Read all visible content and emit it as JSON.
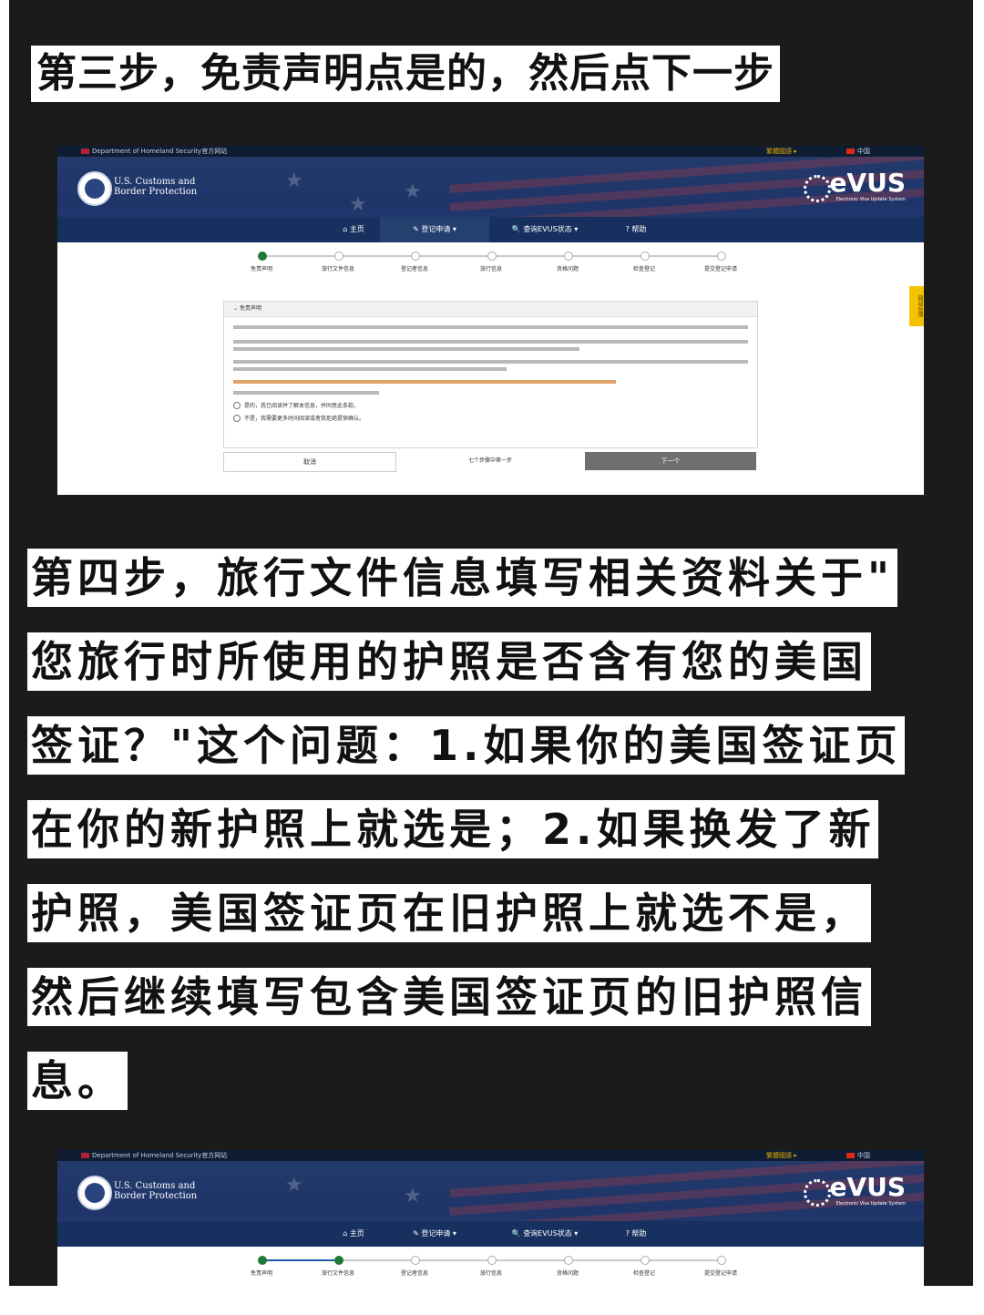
{
  "heading1": "第三步，免责声明点是的，然后点下一步",
  "heading2_lines": [
    "第四步，旅行文件信息填写相关资料关于\"",
    "您旅行时所使用的护照是否含有您的美国",
    "签证？\"这个问题：1.如果你的美国签证页",
    "在你的新护照上就选是；2.如果换发了新",
    "护照，美国签证页在旧护照上就选不是，",
    "然后继续填写包含美国签证页的旧护照信",
    "息。"
  ],
  "screenshot1": {
    "dhs_banner": "Department of Homeland Security官方网站",
    "language_link": "繁體國語 ▸",
    "country": "中国",
    "agency_name": [
      "U.S. Customs and",
      "Border Protection"
    ],
    "logo_text": "eVUS",
    "logo_subtitle": "Electronic Visa Update System",
    "nav": [
      "主页",
      "登记申请",
      "查询EVUS状态",
      "帮助"
    ],
    "active_nav_index": 1,
    "steps": [
      "免责声明",
      "旅行文件信息",
      "登记者信息",
      "旅行信息",
      "资格问题",
      "检查登记",
      "提交登记申请"
    ],
    "current_step": 1,
    "panel_title": "免责声明",
    "options": [
      "是的，我已阅读并了解本信息，并同意此条款。",
      "不是，我需要更多时间阅读或者我拒绝提供确认。"
    ],
    "cancel_label": "取消",
    "step_counter": "七个步骤中第一步",
    "next_label": "下一个",
    "feedback_tab": "网站反馈"
  },
  "screenshot2": {
    "dhs_banner": "Department of Homeland Security官方网站",
    "language_link": "繁體國語 ▸",
    "country": "中国",
    "agency_name": [
      "U.S. Customs and",
      "Border Protection"
    ],
    "logo_text": "eVUS",
    "logo_subtitle": "Electronic Visa Update System",
    "nav": [
      "主页",
      "登记申请",
      "查询EVUS状态",
      "帮助"
    ],
    "steps": [
      "免责声明",
      "旅行文件信息",
      "登记者信息",
      "旅行信息",
      "资格问题",
      "检查登记",
      "提交登记申请"
    ],
    "current_step": 2
  },
  "colors": {
    "page_bg": "#1b1b1b",
    "hero_blue": "#1f356a",
    "nav_blue": "#17305f",
    "done_green": "#1f7a3a",
    "progress_blue": "#1e5aa8",
    "next_gray": "#6f6f6f"
  }
}
